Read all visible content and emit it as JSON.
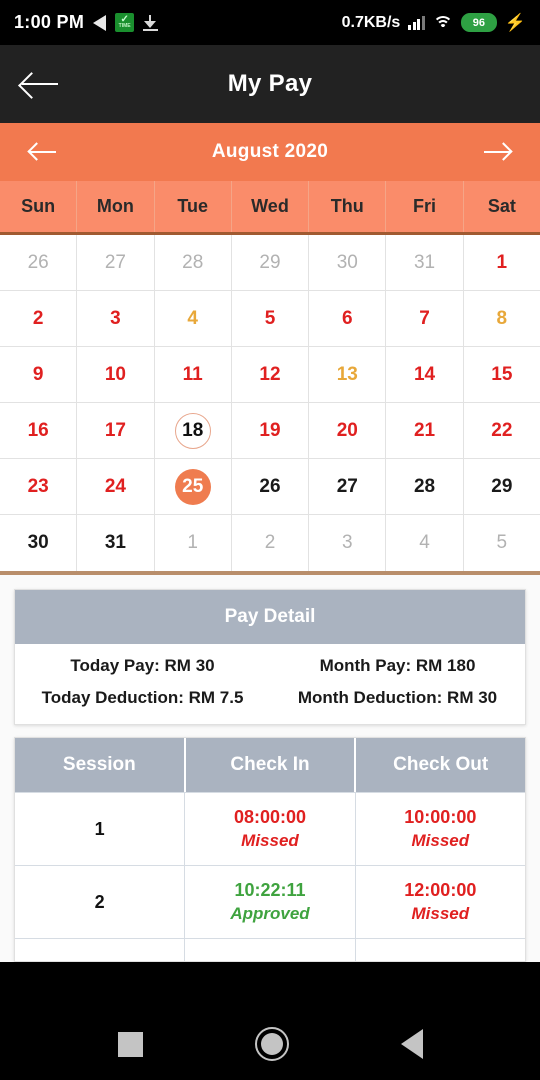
{
  "status_bar": {
    "time": "1:00 PM",
    "network_speed": "0.7KB/s",
    "battery_percent": "96",
    "icons": [
      "media-arrow-icon",
      "time-app-icon",
      "download-icon",
      "signal-icon",
      "wifi-icon",
      "battery-icon",
      "charging-bolt-icon"
    ]
  },
  "app_bar": {
    "title": "My Pay",
    "back_label": "back-arrow-icon"
  },
  "calendar": {
    "month_label": "August 2020",
    "prev_label": "previous-month",
    "next_label": "next-month",
    "weekdays": [
      "Sun",
      "Mon",
      "Tue",
      "Wed",
      "Thu",
      "Fri",
      "Sat"
    ],
    "weeks": [
      [
        {
          "day": "26",
          "style": "d-gray"
        },
        {
          "day": "27",
          "style": "d-gray"
        },
        {
          "day": "28",
          "style": "d-gray"
        },
        {
          "day": "29",
          "style": "d-gray"
        },
        {
          "day": "30",
          "style": "d-gray"
        },
        {
          "day": "31",
          "style": "d-gray"
        },
        {
          "day": "1",
          "style": "d-red"
        }
      ],
      [
        {
          "day": "2",
          "style": "d-red"
        },
        {
          "day": "3",
          "style": "d-red"
        },
        {
          "day": "4",
          "style": "d-amber"
        },
        {
          "day": "5",
          "style": "d-red"
        },
        {
          "day": "6",
          "style": "d-red"
        },
        {
          "day": "7",
          "style": "d-red"
        },
        {
          "day": "8",
          "style": "d-amber"
        }
      ],
      [
        {
          "day": "9",
          "style": "d-red"
        },
        {
          "day": "10",
          "style": "d-red"
        },
        {
          "day": "11",
          "style": "d-red"
        },
        {
          "day": "12",
          "style": "d-red"
        },
        {
          "day": "13",
          "style": "d-amber"
        },
        {
          "day": "14",
          "style": "d-red"
        },
        {
          "day": "15",
          "style": "d-red"
        }
      ],
      [
        {
          "day": "16",
          "style": "d-red"
        },
        {
          "day": "17",
          "style": "d-red"
        },
        {
          "day": "18",
          "style": "d-dark",
          "mark": "today"
        },
        {
          "day": "19",
          "style": "d-red"
        },
        {
          "day": "20",
          "style": "d-red"
        },
        {
          "day": "21",
          "style": "d-red"
        },
        {
          "day": "22",
          "style": "d-red"
        }
      ],
      [
        {
          "day": "23",
          "style": "d-red"
        },
        {
          "day": "24",
          "style": "d-red"
        },
        {
          "day": "25",
          "style": "d-dark",
          "mark": "selected"
        },
        {
          "day": "26",
          "style": "d-dark"
        },
        {
          "day": "27",
          "style": "d-dark"
        },
        {
          "day": "28",
          "style": "d-dark"
        },
        {
          "day": "29",
          "style": "d-dark"
        }
      ],
      [
        {
          "day": "30",
          "style": "d-dark"
        },
        {
          "day": "31",
          "style": "d-dark"
        },
        {
          "day": "1",
          "style": "d-gray"
        },
        {
          "day": "2",
          "style": "d-gray"
        },
        {
          "day": "3",
          "style": "d-gray"
        },
        {
          "day": "4",
          "style": "d-gray"
        },
        {
          "day": "5",
          "style": "d-gray"
        }
      ]
    ],
    "colors": {
      "header": "#F2794F",
      "weekday_row": "#FA8C6A",
      "selected": "#EF7C4F",
      "today_ring": "#E8A68C"
    }
  },
  "pay_detail": {
    "title": "Pay Detail",
    "rows": [
      [
        "Today Pay: RM 30",
        "Month Pay: RM 180"
      ],
      [
        "Today Deduction: RM 7.5",
        "Month Deduction: RM 30"
      ]
    ]
  },
  "session_table": {
    "headers": [
      "Session",
      "Check In",
      "Check Out"
    ],
    "rows": [
      {
        "session": "1",
        "check_in": {
          "time": "08:00:00",
          "status": "Missed",
          "status_style": "st-missed"
        },
        "check_out": {
          "time": "10:00:00",
          "status": "Missed",
          "status_style": "st-missed"
        }
      },
      {
        "session": "2",
        "check_in": {
          "time": "10:22:11",
          "status": "Approved",
          "status_style": "st-approved"
        },
        "check_out": {
          "time": "12:00:00",
          "status": "Missed",
          "status_style": "st-missed"
        }
      }
    ],
    "colors": {
      "header": "#AAB3C0",
      "missed": "#E02020",
      "approved": "#3FA33F"
    }
  },
  "nav_bar": {
    "recents_label": "recents-square",
    "home_label": "home-circle",
    "back_label": "back-triangle"
  }
}
